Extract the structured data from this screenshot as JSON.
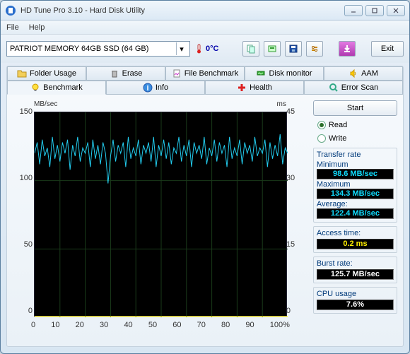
{
  "window": {
    "title": "HD Tune Pro 3.10 - Hard Disk Utility"
  },
  "menu": {
    "file": "File",
    "help": "Help"
  },
  "toolbar": {
    "drive": "PATRIOT MEMORY 64GB SSD (64 GB)",
    "temp": "0°C",
    "exit": "Exit"
  },
  "tabs_top": {
    "folder": "Folder Usage",
    "erase": "Erase",
    "filebench": "File Benchmark",
    "diskmon": "Disk monitor",
    "aam": "AAM"
  },
  "tabs_bottom": {
    "benchmark": "Benchmark",
    "info": "Info",
    "health": "Health",
    "errorscan": "Error Scan"
  },
  "controls": {
    "start": "Start",
    "read": "Read",
    "write": "Write"
  },
  "stats": {
    "transfer_title": "Transfer rate",
    "min_label": "Minimum",
    "min_val": "98.6 MB/sec",
    "max_label": "Maximum",
    "max_val": "134.3 MB/sec",
    "avg_label": "Average:",
    "avg_val": "122.4 MB/sec",
    "access_label": "Access time:",
    "access_val": "0.2 ms",
    "burst_label": "Burst rate:",
    "burst_val": "125.7 MB/sec",
    "cpu_label": "CPU usage",
    "cpu_val": "7.6%"
  },
  "chart_data": {
    "type": "line",
    "title": "",
    "xlabel": "",
    "ylabel_left": "MB/sec",
    "ylabel_right": "ms",
    "x_ticks": [
      "0",
      "10",
      "20",
      "30",
      "40",
      "50",
      "60",
      "70",
      "80",
      "90",
      "100%"
    ],
    "y_ticks_left": [
      "150",
      "100",
      "50",
      "0"
    ],
    "y_ticks_right": [
      "45",
      "30",
      "15",
      "0"
    ],
    "xlim": [
      0,
      100
    ],
    "ylim_left": [
      0,
      150
    ],
    "ylim_right": [
      0,
      45
    ],
    "series": [
      {
        "name": "Transfer rate (MB/sec)",
        "axis": "left",
        "color": "#22ccee",
        "x": [
          0,
          1,
          2,
          3,
          4,
          5,
          6,
          7,
          8,
          9,
          10,
          11,
          12,
          13,
          14,
          15,
          16,
          17,
          18,
          19,
          20,
          21,
          22,
          23,
          24,
          25,
          26,
          27,
          28,
          29,
          30,
          31,
          32,
          33,
          34,
          35,
          36,
          37,
          38,
          39,
          40,
          41,
          42,
          43,
          44,
          45,
          46,
          47,
          48,
          49,
          50,
          51,
          52,
          53,
          54,
          55,
          56,
          57,
          58,
          59,
          60,
          61,
          62,
          63,
          64,
          65,
          66,
          67,
          68,
          69,
          70,
          71,
          72,
          73,
          74,
          75,
          76,
          77,
          78,
          79,
          80,
          81,
          82,
          83,
          84,
          85,
          86,
          87,
          88,
          89,
          90,
          91,
          92,
          93,
          94,
          95,
          96,
          97,
          98,
          99,
          100
        ],
        "values": [
          120,
          128,
          112,
          130,
          118,
          124,
          110,
          132,
          116,
          126,
          114,
          128,
          120,
          130,
          108,
          126,
          118,
          132,
          114,
          124,
          120,
          128,
          110,
          130,
          116,
          126,
          112,
          128,
          120,
          98,
          118,
          130,
          114,
          126,
          120,
          128,
          110,
          132,
          116,
          124,
          118,
          130,
          112,
          126,
          120,
          128,
          114,
          132,
          110,
          126,
          118,
          130,
          116,
          128,
          112,
          124,
          120,
          132,
          114,
          126,
          118,
          130,
          110,
          128,
          120,
          126,
          116,
          132,
          112,
          124,
          118,
          130,
          114,
          128,
          120,
          126,
          110,
          132,
          116,
          124,
          118,
          130,
          112,
          128,
          120,
          126,
          114,
          132,
          118,
          124,
          120,
          130,
          110,
          128,
          116,
          126,
          118,
          134,
          112,
          124,
          120
        ]
      },
      {
        "name": "Access time (ms)",
        "axis": "right",
        "color": "#ffee00",
        "x": [
          0,
          100
        ],
        "values": [
          0.2,
          0.2
        ]
      }
    ]
  }
}
